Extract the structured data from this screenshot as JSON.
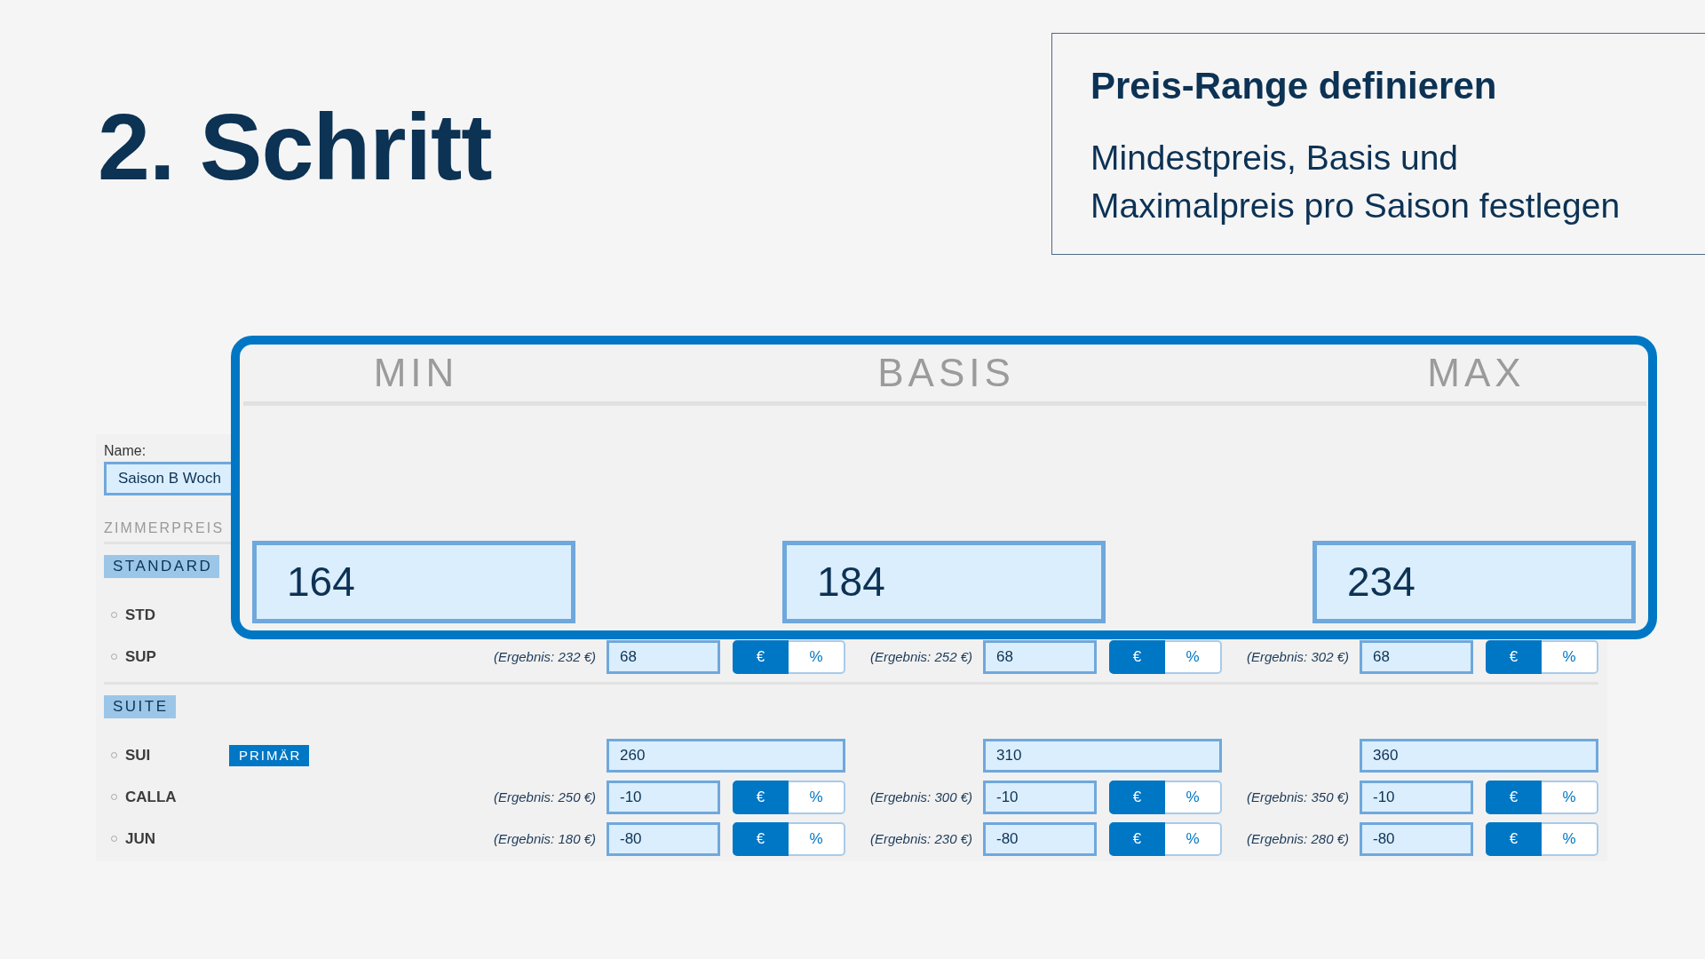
{
  "step_title": "2. Schritt",
  "info_box": {
    "title": "Preis-Range definieren",
    "text": "Mindestpreis, Basis und Maximalpreis pro Saison festlegen"
  },
  "form": {
    "name_label": "Name:",
    "name_value": "Saison B Woch",
    "section_heading": "ZIMMERPREIS",
    "room_groups": [
      {
        "tag": "STANDARD",
        "rooms": [
          {
            "code": "STD"
          },
          {
            "code": "SUP",
            "prices": [
              {
                "kind": "offset",
                "result": "(Ergebnis: 232 €)",
                "value": "68",
                "units": [
                  {
                    "label": "€",
                    "selected": true
                  },
                  {
                    "label": "%",
                    "selected": false
                  }
                ]
              },
              {
                "kind": "offset",
                "result": "(Ergebnis: 252 €)",
                "value": "68",
                "units": [
                  {
                    "label": "€",
                    "selected": true
                  },
                  {
                    "label": "%",
                    "selected": false
                  }
                ]
              },
              {
                "kind": "offset",
                "result": "(Ergebnis: 302 €)",
                "value": "68",
                "units": [
                  {
                    "label": "€",
                    "selected": true
                  },
                  {
                    "label": "%",
                    "selected": false
                  }
                ]
              }
            ]
          }
        ]
      },
      {
        "tag": "SUITE",
        "rooms": [
          {
            "code": "SUI",
            "badge": "PRIMÄR",
            "prices": [
              {
                "kind": "base",
                "value": "260"
              },
              {
                "kind": "base",
                "value": "310"
              },
              {
                "kind": "base",
                "value": "360"
              }
            ]
          },
          {
            "code": "CALLA",
            "prices": [
              {
                "kind": "offset",
                "result": "(Ergebnis: 250 €)",
                "value": "-10",
                "units": [
                  {
                    "label": "€",
                    "selected": true
                  },
                  {
                    "label": "%",
                    "selected": false
                  }
                ]
              },
              {
                "kind": "offset",
                "result": "(Ergebnis: 300 €)",
                "value": "-10",
                "units": [
                  {
                    "label": "€",
                    "selected": true
                  },
                  {
                    "label": "%",
                    "selected": false
                  }
                ]
              },
              {
                "kind": "offset",
                "result": "(Ergebnis: 350 €)",
                "value": "-10",
                "units": [
                  {
                    "label": "€",
                    "selected": true
                  },
                  {
                    "label": "%",
                    "selected": false
                  }
                ]
              }
            ]
          },
          {
            "code": "JUN",
            "prices": [
              {
                "kind": "offset",
                "result": "(Ergebnis: 180 €)",
                "value": "-80",
                "units": [
                  {
                    "label": "€",
                    "selected": true
                  },
                  {
                    "label": "%",
                    "selected": false
                  }
                ]
              },
              {
                "kind": "offset",
                "result": "(Ergebnis: 230 €)",
                "value": "-80",
                "units": [
                  {
                    "label": "€",
                    "selected": true
                  },
                  {
                    "label": "%",
                    "selected": false
                  }
                ]
              },
              {
                "kind": "offset",
                "result": "(Ergebnis: 280 €)",
                "value": "-80",
                "units": [
                  {
                    "label": "€",
                    "selected": true
                  },
                  {
                    "label": "%",
                    "selected": false
                  }
                ]
              }
            ]
          }
        ]
      }
    ]
  },
  "callout": {
    "columns": [
      {
        "header": "MIN",
        "value": "164"
      },
      {
        "header": "BASIS",
        "value": "184"
      },
      {
        "header": "MAX",
        "value": "234"
      }
    ]
  }
}
